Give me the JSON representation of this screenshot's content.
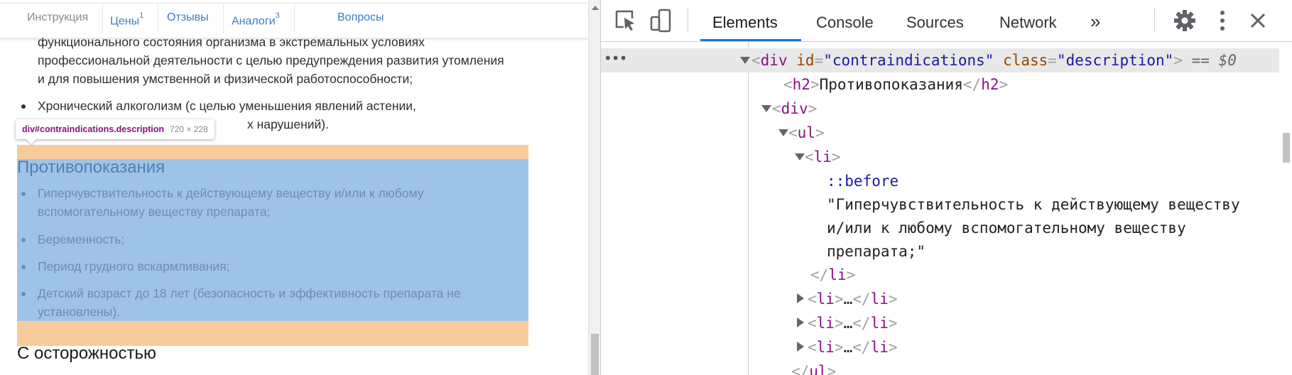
{
  "page": {
    "tabs": [
      {
        "label": "Инструкция",
        "sup": ""
      },
      {
        "label": "Цены",
        "sup": "1"
      },
      {
        "label": "Отзывы",
        "sup": ""
      },
      {
        "label": "Аналоги",
        "sup": "3"
      },
      {
        "label": "Вопросы",
        "sup": ""
      }
    ],
    "text_lines": [
      "функционального состояния организма в экстремальных условиях",
      "профессиональной деятельности с целью предупреждения развития утомления",
      "и для повышения умственной и физической работоспособности;",
      "Хронический алкоголизм (с целью уменьшения явлений астении,",
      "х нарушений)."
    ],
    "tooltip": {
      "tag": "div#contraindications.description",
      "size": "720 × 228"
    },
    "section_heading": "Противопоказания",
    "items": [
      "Гиперчувствительность к действующему веществу и/или к любому",
      "вспомогательному веществу препарата;",
      "Беременность;",
      "Период грудного вскармливания;",
      "Детский возраст до 18 лет (безопасность и эффективность препарата не",
      "установлены)."
    ],
    "next_heading": "С осторожностью"
  },
  "devtools": {
    "tabs": [
      "Elements",
      "Console",
      "Sources",
      "Network"
    ],
    "more": "»",
    "dots": "•••",
    "lines": {
      "div_open_tag": "div",
      "attr_id_name": "id",
      "attr_id_value": "\"contraindications\"",
      "attr_class_name": "class",
      "attr_class_value": "\"description\"",
      "selected_marker": "== $0",
      "h2_tag": "h2",
      "h2_text": "Противопоказания",
      "inner_div_tag": "div",
      "ul_tag": "ul",
      "li_tag": "li",
      "pseudo": "::before",
      "text_1": "\"Гиперчувствительность к действующему веществу",
      "text_2": "и/или к любому вспомогательному веществу",
      "text_3": "препарата;\"",
      "ellipsis": "…",
      "ul_close": "ul"
    }
  },
  "colors": {
    "highlight_content": "#9fc3e7",
    "highlight_padding": "#f8cb9c",
    "tag": "#881280",
    "attr_name": "#994500",
    "attr_value": "#1a1aa6",
    "active_tab_underline": "#1a73e8"
  }
}
